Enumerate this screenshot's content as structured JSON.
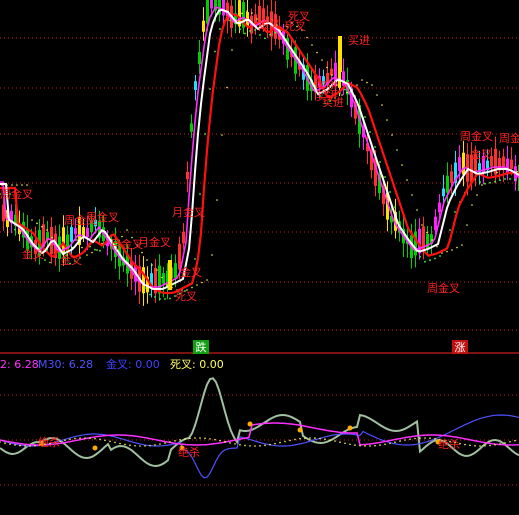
{
  "colors": {
    "background": "#000000",
    "grid_red": "#c81e1e",
    "candle_up": "#ff3030",
    "candle_down": "#00d000",
    "candle_magenta": "#ff20ff",
    "candle_cyan": "#20e0ff",
    "candle_yellow": "#ffe000",
    "ma_white": "#ffffff",
    "ma_red": "#ff1010",
    "ma_magenta": "#ff30ff",
    "ma_blue": "#4040ff",
    "dots_green": "#40ff40",
    "dots_yellow": "#ffff60",
    "label_red": "#ff2020",
    "osc_gray": "#a0c0a0",
    "osc_white": "#ffffff",
    "osc_magenta": "#ff30ff",
    "osc_blue": "#5050ff",
    "osc_yellow_dots": "#ffff60",
    "badge_green": "#10a010",
    "badge_red": "#c01010"
  },
  "badges": {
    "down": "跌",
    "up": "涨"
  },
  "indicator_bar": {
    "item1_label": "2: 6.28",
    "item2_label": "M30: 6.28",
    "item3_label": "金叉: 0.00",
    "item4_label": "死叉: 0.00"
  },
  "chart_data": {
    "type": "line",
    "upper_panel_series": [
      {
        "name": "white",
        "values": [
          205,
          205,
          210,
          215,
          220,
          222,
          225,
          228,
          230,
          232,
          232,
          230,
          228,
          228,
          230,
          232,
          232,
          234,
          236,
          238,
          240,
          238,
          236,
          240,
          242,
          244,
          244,
          246,
          248,
          250,
          252,
          250,
          248,
          250,
          248,
          246,
          240,
          200,
          150,
          100,
          70,
          50,
          38,
          28,
          22,
          18,
          14,
          10,
          8,
          6,
          5,
          6,
          8,
          12,
          16,
          22,
          30,
          40,
          50,
          60,
          68,
          74,
          78,
          80,
          84,
          84,
          82,
          84,
          86,
          90,
          96,
          104,
          112,
          122,
          132,
          146,
          162,
          178,
          194,
          210,
          222,
          230,
          236,
          240,
          238,
          232,
          222,
          212,
          202,
          192,
          186,
          182,
          178,
          176,
          176,
          178,
          180,
          182,
          182
        ]
      },
      {
        "name": "red",
        "values": [
          180,
          185,
          190,
          195,
          200,
          205,
          210,
          215,
          218,
          220,
          222,
          224,
          226,
          228,
          230,
          232,
          234,
          236,
          238,
          240,
          242,
          244,
          246,
          248,
          250,
          252,
          254,
          258,
          262,
          266,
          268,
          270,
          270,
          268,
          265,
          260,
          250,
          230,
          205,
          180,
          155,
          130,
          110,
          95,
          82,
          72,
          62,
          52,
          44,
          38,
          32,
          28,
          26,
          26,
          28,
          32,
          38,
          44,
          50,
          58,
          64,
          70,
          76,
          80,
          84,
          88,
          92,
          96,
          100,
          104,
          108,
          114,
          120,
          128,
          136,
          144,
          152,
          160,
          168,
          176,
          184,
          192,
          200,
          206,
          210,
          210,
          206,
          200,
          192,
          184,
          178,
          174,
          170,
          168,
          168,
          168,
          168,
          170,
          172
        ]
      }
    ],
    "labels_upper": [
      "死叉",
      "买进",
      "买进",
      "买进",
      "金叉",
      "月金叉",
      "周金叉",
      "月金叉",
      "金叉",
      "死叉",
      "金叉",
      "金叉",
      "死叉",
      "买进",
      "周金叉",
      "月金叉",
      "周金叉",
      "周金叉",
      "金叉",
      "周金叉",
      "周金叉"
    ],
    "labels_lower": [
      "绝杀",
      "绝杀",
      "绝杀"
    ]
  }
}
